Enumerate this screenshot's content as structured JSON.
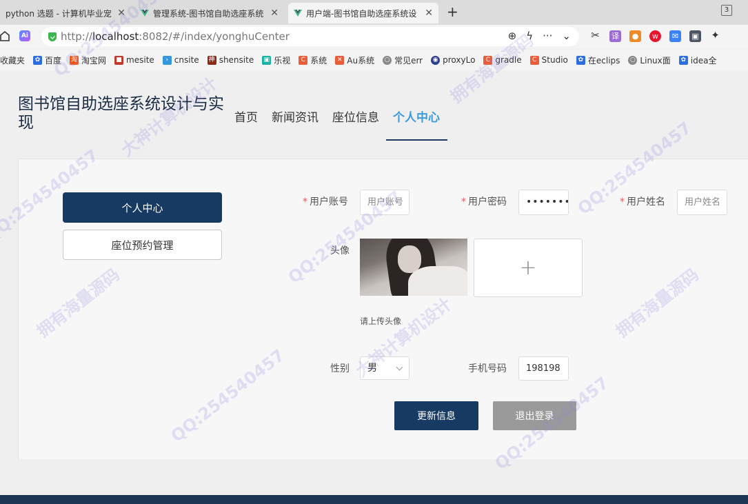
{
  "browser": {
    "tabs": [
      {
        "label": "python 选题 - 计算机毕业宠",
        "active": false
      },
      {
        "label": "管理系统-图书馆自助选座系统",
        "active": false
      },
      {
        "label": "用户端-图书馆自助选座系统设",
        "active": true
      }
    ],
    "tab_count": "3",
    "url_prefix": "http://",
    "url_host": "localhost",
    "url_rest": ":8082/#/index/yonghuCenter",
    "bookmarks": [
      "收藏夹",
      "百度",
      "淘宝网",
      "mesite",
      "cnsite",
      "shensite",
      "乐视",
      "系统",
      "Au系统",
      "常见err",
      "proxyLo",
      "gradle",
      "Studio",
      "在eclips",
      "Linux面",
      "idea全"
    ]
  },
  "site": {
    "title": "图书馆自助选座系统设计与实现",
    "nav": [
      "首页",
      "新闻资讯",
      "座位信息",
      "个人中心"
    ],
    "nav_active_index": 3
  },
  "sidebar": {
    "items": [
      {
        "label": "个人中心",
        "active": true
      },
      {
        "label": "座位预约管理",
        "active": false
      }
    ]
  },
  "form": {
    "account_label": "用户账号",
    "account_value": "用户账号",
    "password_label": "用户密码",
    "password_value": "••••••••••",
    "name_label": "用户姓名",
    "name_value": "用户姓名",
    "avatar_label": "头像",
    "upload_hint": "请上传头像",
    "gender_label": "性别",
    "gender_value": "男",
    "phone_label": "手机号码",
    "phone_value": "198198",
    "update_button": "更新信息",
    "logout_button": "退出登录"
  },
  "watermark": {
    "qq": "QQ:254540457",
    "slogan1": "大神计算机设计",
    "slogan2": "拥有海量源码"
  },
  "colors": {
    "primary": "#173a63",
    "nav_active": "#3b9ad9",
    "required": "#e05a5a",
    "logout": "#9a9a9a"
  }
}
